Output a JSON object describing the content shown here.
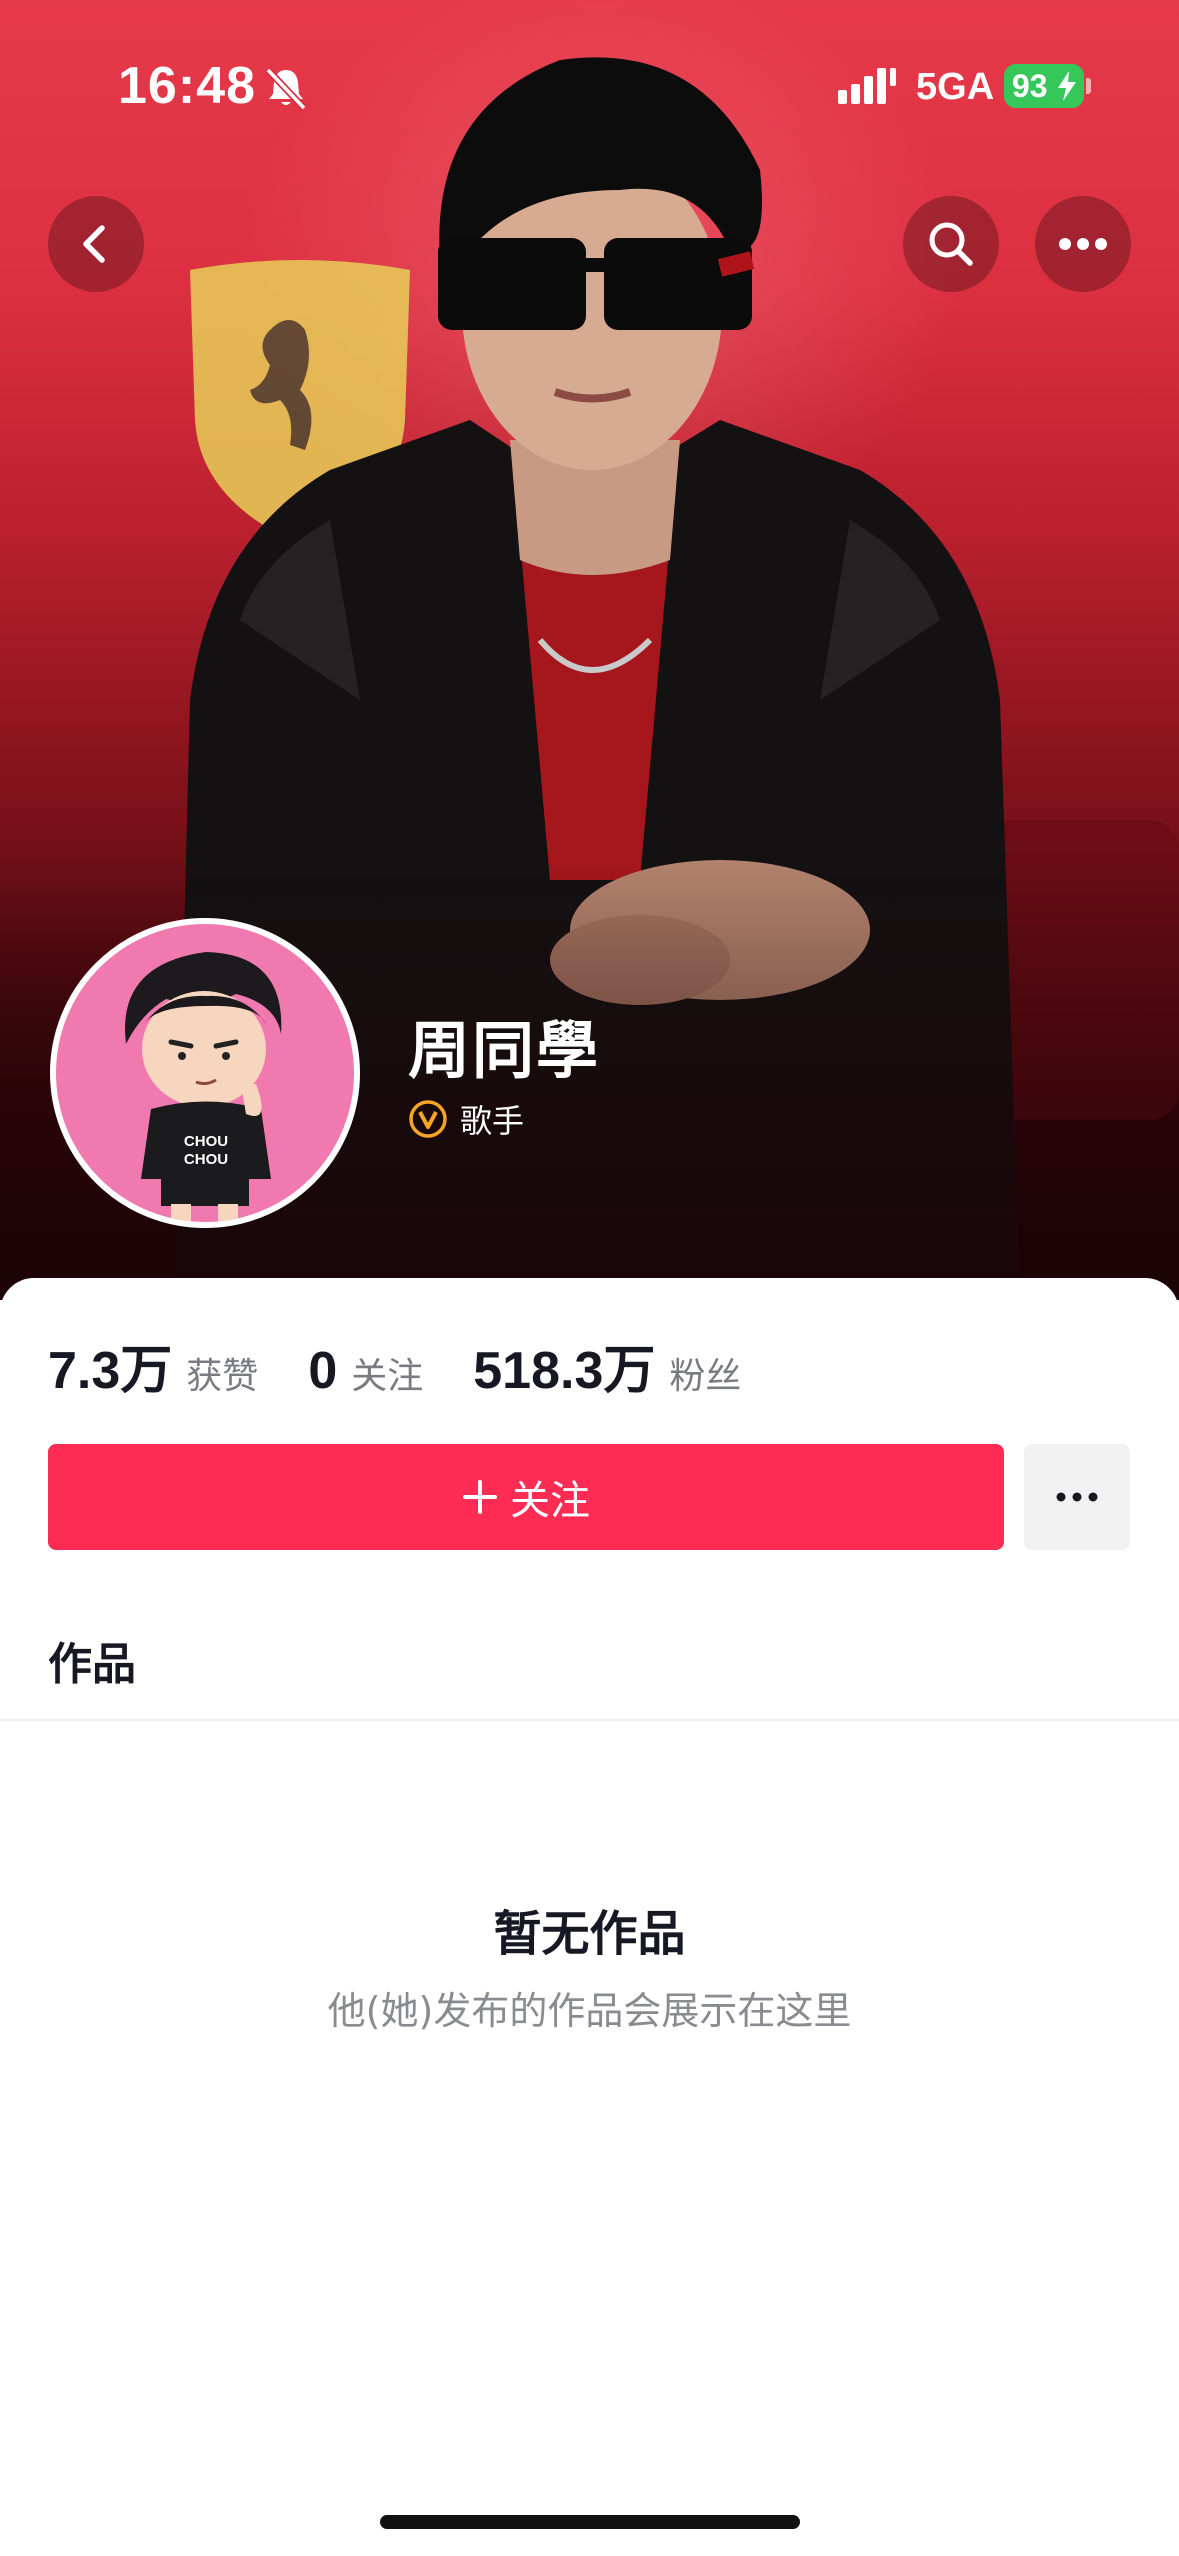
{
  "status_bar": {
    "time": "16:48",
    "network": "5GA",
    "battery": "93"
  },
  "nav": {
    "back_icon": "chevron-left-icon",
    "search_icon": "search-icon",
    "more_icon": "more-horizontal-icon"
  },
  "profile": {
    "name": "周同學",
    "verified_icon": "verified-v-icon",
    "role": "歌手",
    "avatar_badge_text": "CHOU CHOU"
  },
  "stats": [
    {
      "value": "7.3万",
      "label": "获赞"
    },
    {
      "value": "0",
      "label": "关注"
    },
    {
      "value": "518.3万",
      "label": "粉丝"
    }
  ],
  "actions": {
    "follow_label": "关注",
    "more_icon": "more-horizontal-icon"
  },
  "tabs": {
    "works_label": "作品"
  },
  "empty_state": {
    "title": "暂无作品",
    "description": "他(她)发布的作品会展示在这里"
  },
  "colors": {
    "banner_red": "#dc3041",
    "follow_button": "#fe2c55",
    "battery_green": "#35c759",
    "avatar_bg": "#f07ab0",
    "verify_gold": "#f5a623"
  }
}
